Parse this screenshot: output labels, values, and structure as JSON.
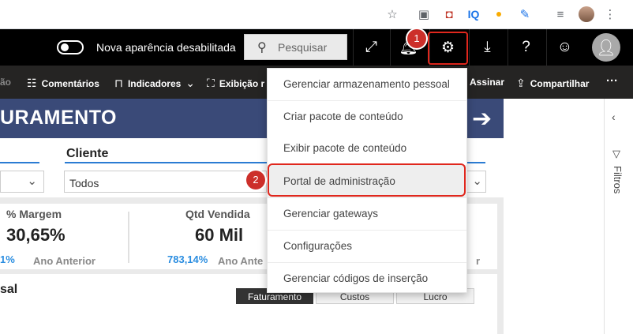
{
  "browser": {
    "icons": [
      "star-icon",
      "extension-icon",
      "pocket-icon",
      "iq-icon",
      "dot-icon",
      "pen-icon",
      "playlist-icon",
      "profile-icon",
      "more-vert-icon"
    ],
    "iq_label": "IQ"
  },
  "header": {
    "toggle_label": "Nova aparência desabilitada",
    "search_placeholder": "Pesquisar",
    "buttons": [
      "expand-icon",
      "notifications-icon",
      "gear-icon",
      "download-icon",
      "help-icon",
      "feedback-icon",
      "account-icon"
    ]
  },
  "actionbar": {
    "partial_left": "ão",
    "comments": "Comentários",
    "bookmarks": "Indicadores",
    "view": "Exibição r",
    "subscribe": "Assinar",
    "share": "Compartilhar",
    "more": "···"
  },
  "report": {
    "banner_title": "URAMENTO",
    "slicer_client_title": "Cliente",
    "slicer_client_value": "Todos",
    "kpis": [
      {
        "label": "% Margem",
        "value": "30,65%",
        "pct": "1%",
        "prev": "Ano Anterior"
      },
      {
        "label": "Qtd Vendida",
        "value": "60 Mil",
        "pct": "783,14%",
        "prev": "Ano Ante"
      }
    ],
    "kpi3_tail": "r",
    "chart_title": "sal",
    "chart_tabs": [
      "Faturamento",
      "Custos",
      "Lucro"
    ]
  },
  "filters_pane": {
    "label": "Filtros"
  },
  "settings_menu": {
    "items": [
      "Gerenciar armazenamento pessoal",
      "Criar pacote de conteúdo",
      "Exibir pacote de conteúdo",
      "Portal de administração",
      "Gerenciar gateways",
      "Configurações",
      "Gerenciar códigos de inserção"
    ],
    "highlighted_index": 3
  },
  "annotations": {
    "badge_1": "1",
    "badge_2": "2",
    "color": "#cc2f2a"
  }
}
